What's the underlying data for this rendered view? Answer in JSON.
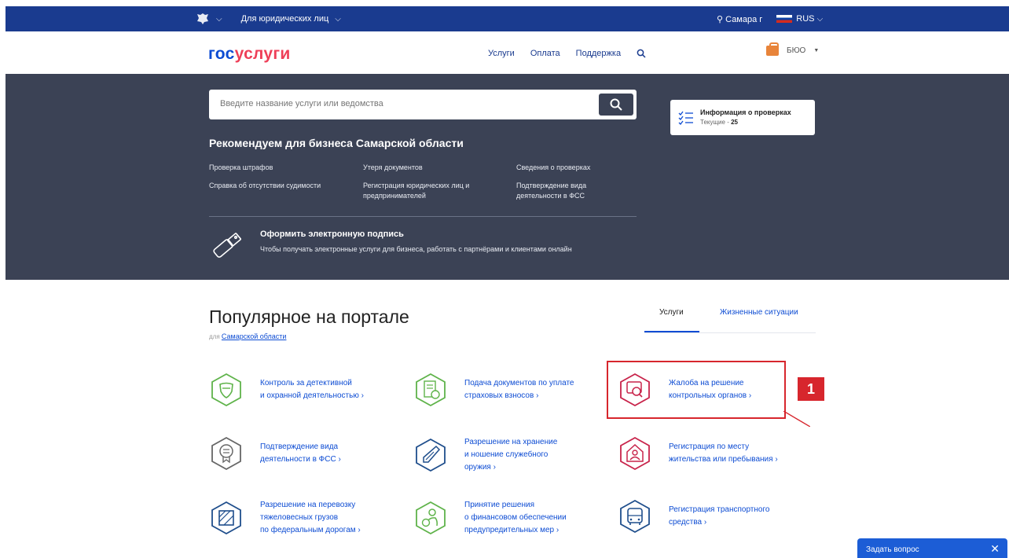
{
  "topbar": {
    "segment": "Для юридических лиц",
    "location": "Самара г",
    "language": "RUS"
  },
  "header": {
    "logo_gos": "гос",
    "logo_uslugi": "услуги",
    "nav": [
      "Услуги",
      "Оплата",
      "Поддержка"
    ],
    "user": "БЮО"
  },
  "hero": {
    "search_placeholder": "Введите название услуги или ведомства",
    "recommend_title": "Рекомендуем для бизнеса Самарской области",
    "recommend_links": [
      "Проверка штрафов",
      "Утеря документов",
      "Сведения о проверках",
      "Справка об отсутствии судимости",
      "Регистрация юридических лиц и",
      "предпринимателей",
      "Подтверждение вида",
      "деятельности в ФСС"
    ],
    "sign_title": "Оформить электронную подпись",
    "sign_text": "Чтобы получать электронные услуги для бизнеса, работать с партнёрами и клиентами онлайн",
    "checks_title": "Информация о проверках",
    "checks_current_label": "Текущие - ",
    "checks_current_value": "25"
  },
  "popular": {
    "title": "Популярное на портале",
    "sub_prefix": "для",
    "sub_region": "Самарской области",
    "tabs": [
      "Услуги",
      "Жизненные ситуации"
    ],
    "services": [
      [
        "Контроль за детективной",
        "и охранной деятельностью ›"
      ],
      [
        "Подача документов по уплате",
        "страховых взносов ›"
      ],
      [
        "Жалоба на решение",
        "контрольных органов ›"
      ],
      [
        "Подтверждение вида",
        "деятельности в ФСС ›"
      ],
      [
        "Разрешение на хранение",
        "и ношение служебного",
        "оружия ›"
      ],
      [
        "Регистрация по месту",
        "жительства или пребывания ›"
      ],
      [
        "Разрешение на перевозку",
        "тяжеловесных грузов",
        "по федеральным дорогам ›"
      ],
      [
        "Принятие решения",
        "о финансовом обеспечении",
        "предупредительных мер ›"
      ],
      [
        "Регистрация транспортного",
        "средства ›"
      ]
    ]
  },
  "annotation": {
    "badge": "1"
  },
  "chat": {
    "label": "Задать вопрос",
    "close": "✕"
  },
  "colors": {
    "brand_blue": "#0d4cd3",
    "top_bar": "#1a3b8f",
    "hero_bg": "#3b4255",
    "accent_red": "#ee3f58",
    "highlight": "#d7262d"
  }
}
